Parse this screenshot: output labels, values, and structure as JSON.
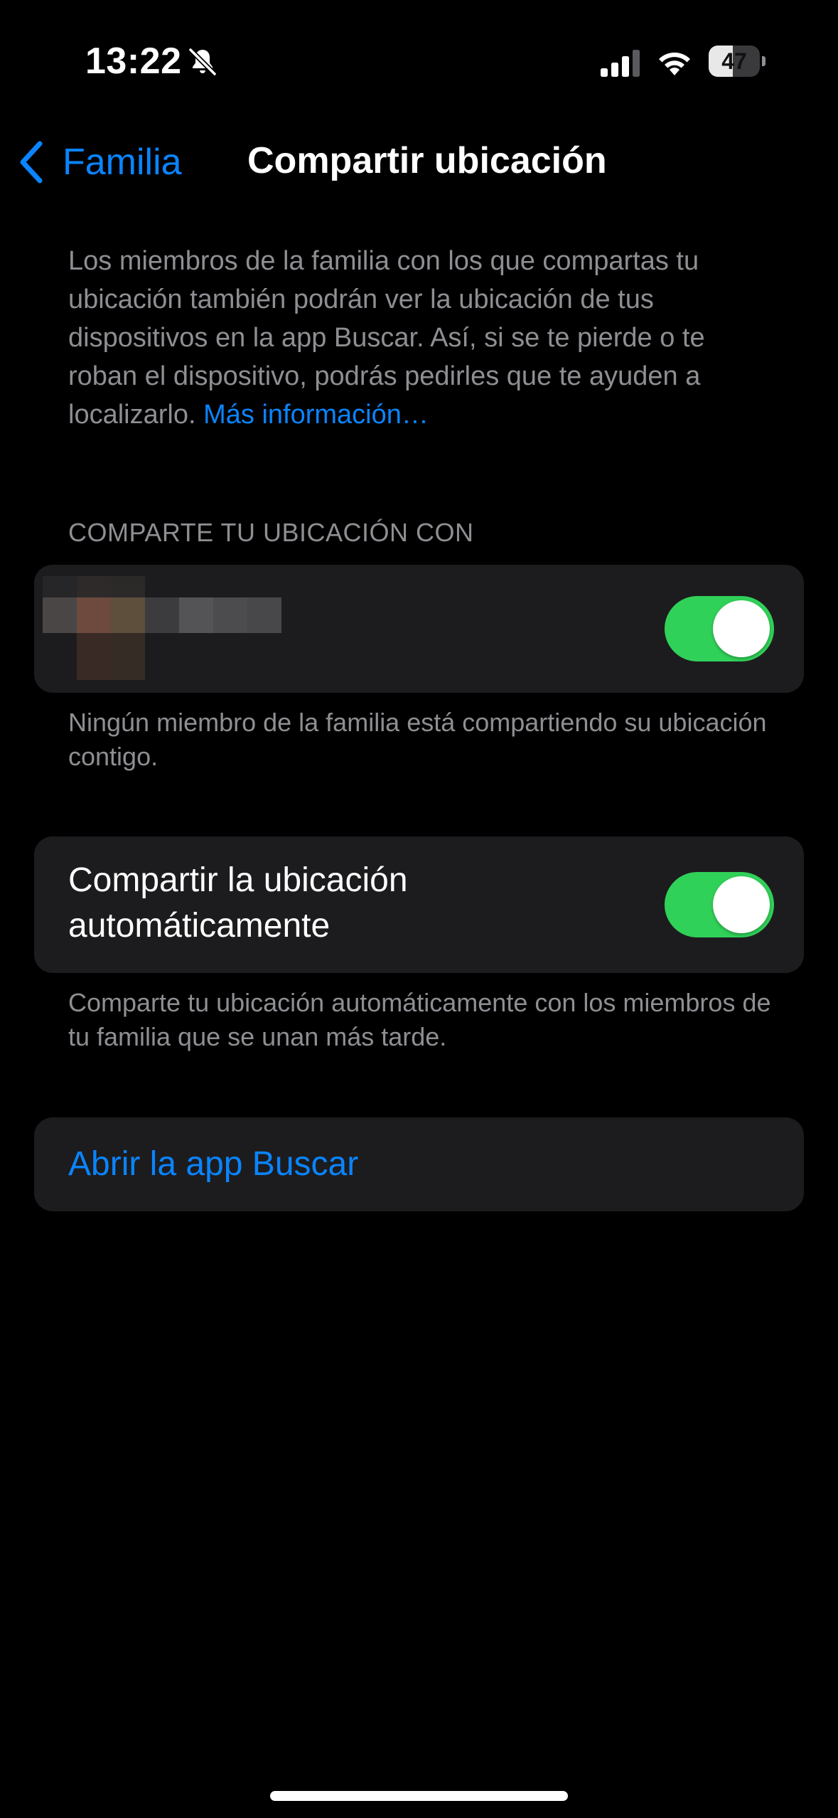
{
  "status_bar": {
    "time": "13:22",
    "battery_percent": "47",
    "battery_level": 0.47,
    "icons": [
      "bell-slash-icon",
      "cellular-signal-icon",
      "wifi-icon",
      "battery-icon"
    ]
  },
  "nav": {
    "back_label": "Familia",
    "title": "Compartir ubicación"
  },
  "intro": {
    "text": "Los miembros de la familia con los que compartas tu ubicación también podrán ver la ubicación de tus dispositivos en la app Buscar. Así, si se te pierde o te roban el dispositivo, podrás pedirles que te ayuden a localizarlo.",
    "link": "Más información…"
  },
  "share_section": {
    "header": "COMPARTE TU UBICACIÓN CON",
    "member": {
      "toggle_on": true
    },
    "footer": "Ningún miembro de la familia está compartiendo su ubicación contigo."
  },
  "auto_section": {
    "label": "Compartir la ubicación automáticamente",
    "toggle_on": true,
    "footer": "Comparte tu ubicación automáticamente con los miembros de tu familia que se unan más tarde."
  },
  "open_app": {
    "label": "Abrir la app Buscar"
  },
  "colors": {
    "background": "#000000",
    "cell": "#1c1c1e",
    "accent": "#0a84ff",
    "toggle_on": "#30d158",
    "secondary_text": "#8e8e93"
  }
}
